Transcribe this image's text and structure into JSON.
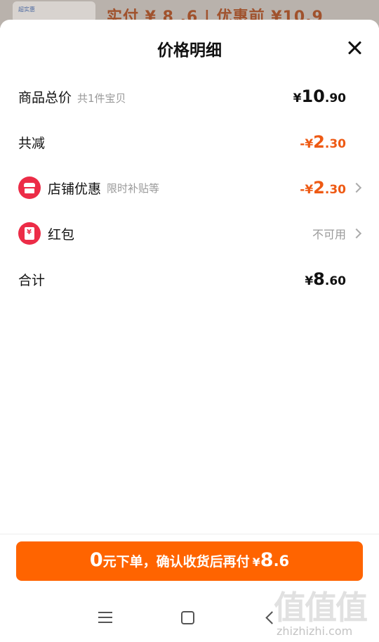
{
  "background": {
    "thumb_text": "超实惠",
    "text": "实付 ¥ 8 .6 | 优惠前 ¥10.9"
  },
  "sheet": {
    "title": "价格明细",
    "close_icon": "close-icon"
  },
  "rows": {
    "total": {
      "label": "商品总价",
      "sub": "共1件宝贝",
      "yen": "¥",
      "int": "10",
      "dec": ".90"
    },
    "discount": {
      "label": "共减",
      "prefix": "-¥",
      "int": "2",
      "dec": ".30"
    },
    "shop_promo": {
      "label": "店铺优惠",
      "sub": "限时补贴等",
      "prefix": "-¥",
      "int": "2",
      "dec": ".30",
      "icon": "shop-icon"
    },
    "red_packet": {
      "label": "红包",
      "status": "不可用",
      "icon": "red-packet-icon"
    },
    "sum": {
      "label": "合计",
      "yen": "¥",
      "int": "8",
      "dec": ".60"
    }
  },
  "cta": {
    "zero": "0",
    "text": "元下单，确认收货后再付",
    "yen": "¥",
    "int": "8",
    "dec": ".6"
  },
  "nav": {
    "menu_icon": "menu-icon",
    "home_icon": "home-icon",
    "back_icon": "back-icon"
  },
  "watermark": {
    "big": "值值值",
    "small": "zhizhizhi.com"
  },
  "colors": {
    "accent": "#ff6400",
    "discount": "#ee5a14",
    "icon_red": "#ec2c47"
  }
}
